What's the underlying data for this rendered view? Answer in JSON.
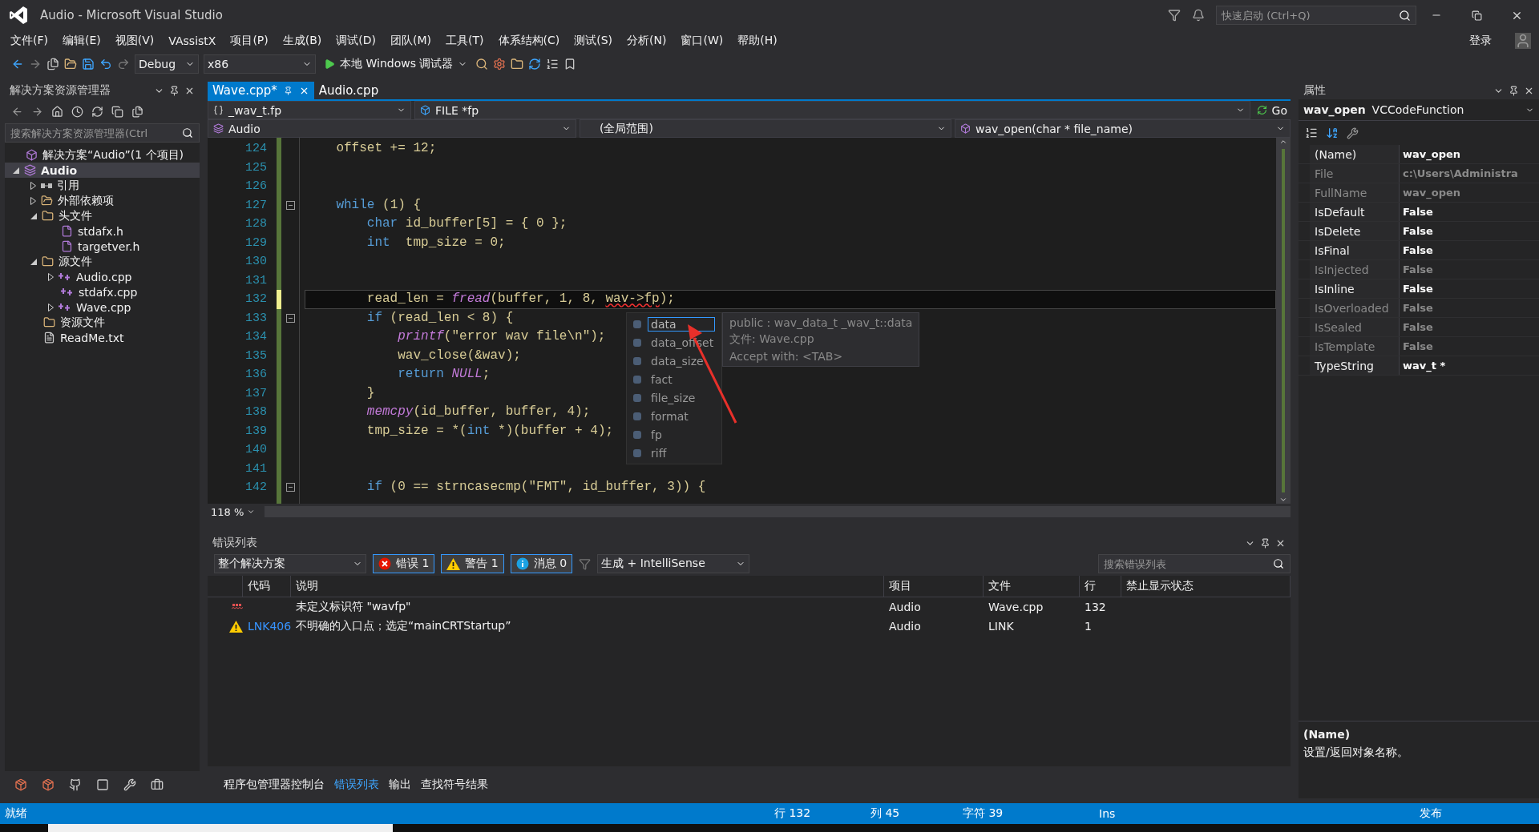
{
  "window": {
    "title": "Audio - Microsoft Visual Studio",
    "quick_launch": {
      "placeholder": "快速启动 (Ctrl+Q)"
    },
    "sign_in": "登录"
  },
  "menu": [
    "文件(F)",
    "编辑(E)",
    "视图(V)",
    "VAssistX",
    "项目(P)",
    "生成(B)",
    "调试(D)",
    "团队(M)",
    "工具(T)",
    "体系结构(C)",
    "测试(S)",
    "分析(N)",
    "窗口(W)",
    "帮助(H)"
  ],
  "toolbar": {
    "configuration": "Debug",
    "platform": "x86",
    "debugger": "本地 Windows 调试器"
  },
  "solution_explorer": {
    "title": "解决方案资源管理器",
    "search": {
      "placeholder": "搜索解决方案资源管理器(Ctrl"
    },
    "tree": [
      {
        "label": "解决方案“Audio”(1 个项目)",
        "kind": "solution",
        "selected": false
      },
      {
        "label": "Audio",
        "kind": "project",
        "selected": true,
        "expanded": true,
        "children": [
          {
            "label": "引用",
            "kind": "references",
            "selected": false,
            "expanded": false
          },
          {
            "label": "外部依赖项",
            "kind": "external",
            "selected": false,
            "expanded": false
          },
          {
            "label": "头文件",
            "kind": "folder",
            "selected": false,
            "expanded": true,
            "children": [
              {
                "label": "stdafx.h",
                "kind": "header",
                "selected": false
              },
              {
                "label": "targetver.h",
                "kind": "header",
                "selected": false
              }
            ]
          },
          {
            "label": "源文件",
            "kind": "folder",
            "selected": false,
            "expanded": true,
            "children": [
              {
                "label": "Audio.cpp",
                "kind": "cpp",
                "selected": false,
                "expanded": false
              },
              {
                "label": "stdafx.cpp",
                "kind": "cpp",
                "selected": false
              },
              {
                "label": "Wave.cpp",
                "kind": "cpp",
                "selected": false,
                "expanded": false
              }
            ]
          },
          {
            "label": "资源文件",
            "kind": "folder",
            "selected": false
          },
          {
            "label": "ReadMe.txt",
            "kind": "text",
            "selected": false
          }
        ]
      }
    ]
  },
  "editor": {
    "tabs": [
      {
        "label": "Wave.cpp*",
        "selected": true
      },
      {
        "label": "Audio.cpp",
        "selected": false
      }
    ],
    "nav_member": "_wav_t.fp",
    "nav_type": "FILE *fp",
    "go": "Go",
    "nav_project": "Audio",
    "nav_scope": "(全局范围)",
    "nav_function": "wav_open(char * file_name)",
    "zoom": "118 %",
    "lines": [
      {
        "number": "124",
        "tokens": [
          {
            "text": "    offset += 12;",
            "kind": "plain"
          }
        ]
      },
      {
        "number": "125"
      },
      {
        "number": "126"
      },
      {
        "number": "127",
        "fold": true,
        "tokens": [
          {
            "text": "    while",
            "kind": "keyword"
          },
          {
            "text": " (1) {",
            "kind": "plain"
          }
        ]
      },
      {
        "number": "128",
        "tokens": [
          {
            "text": "        char",
            "kind": "keyword"
          },
          {
            "text": " id_buffer[5] = { 0 };",
            "kind": "plain"
          }
        ]
      },
      {
        "number": "129",
        "tokens": [
          {
            "text": "        int",
            "kind": "keyword"
          },
          {
            "text": "  tmp_size = 0;",
            "kind": "plain"
          }
        ]
      },
      {
        "number": "130"
      },
      {
        "number": "131"
      },
      {
        "number": "132",
        "current": true,
        "tokens": [
          {
            "text": "        read_len = ",
            "kind": "plain"
          },
          {
            "text": "fread",
            "kind": "function"
          },
          {
            "text": "(buffer, 1, 8, ",
            "kind": "plain"
          },
          {
            "text": "wav->fp",
            "kind": "error"
          },
          {
            "text": ");",
            "kind": "plain"
          }
        ]
      },
      {
        "number": "133",
        "fold": true,
        "tokens": [
          {
            "text": "        if",
            "kind": "keyword"
          },
          {
            "text": " (read_len < 8) {",
            "kind": "plain"
          }
        ]
      },
      {
        "number": "134",
        "tokens": [
          {
            "text": "            printf",
            "kind": "function"
          },
          {
            "text": "(\"error wav file\\n\");",
            "kind": "plain"
          }
        ]
      },
      {
        "number": "135",
        "tokens": [
          {
            "text": "            wav_close(&wav);",
            "kind": "plain"
          }
        ]
      },
      {
        "number": "136",
        "tokens": [
          {
            "text": "            return",
            "kind": "keyword"
          },
          {
            "text": " NULL",
            "kind": "function"
          },
          {
            "text": ";",
            "kind": "plain"
          }
        ]
      },
      {
        "number": "137",
        "tokens": [
          {
            "text": "        }",
            "kind": "plain"
          }
        ]
      },
      {
        "number": "138",
        "tokens": [
          {
            "text": "        memcpy",
            "kind": "function"
          },
          {
            "text": "(id_buffer, buffer, 4);",
            "kind": "plain"
          }
        ]
      },
      {
        "number": "139",
        "tokens": [
          {
            "text": "        tmp_size = *(",
            "kind": "plain"
          },
          {
            "text": "int",
            "kind": "keyword"
          },
          {
            "text": " *)(buffer + 4);",
            "kind": "plain"
          }
        ]
      },
      {
        "number": "140"
      },
      {
        "number": "141"
      },
      {
        "number": "142",
        "fold": true,
        "tokens": [
          {
            "text": "        if",
            "kind": "keyword"
          },
          {
            "text": " (0 == strncasecmp(\"FMT\", id_buffer, 3)) {",
            "kind": "plain"
          }
        ]
      }
    ],
    "completion": {
      "items": [
        {
          "label": "data",
          "selected": true
        },
        {
          "label": "data_offset",
          "selected": false
        },
        {
          "label": "data_size",
          "selected": false
        },
        {
          "label": "fact",
          "selected": false
        },
        {
          "label": "file_size",
          "selected": false
        },
        {
          "label": "format",
          "selected": false
        },
        {
          "label": "fp",
          "selected": false
        },
        {
          "label": "riff",
          "selected": false
        }
      ],
      "tooltip": [
        "public : wav_data_t _wav_t::data",
        "文件: Wave.cpp",
        "Accept with: <TAB>"
      ]
    }
  },
  "error_list": {
    "title": "错误列表",
    "scope": "整个解决方案",
    "filters": [
      {
        "kind": "error",
        "label": "错误 1",
        "selected": true
      },
      {
        "kind": "warning",
        "label": "警告 1",
        "selected": true
      },
      {
        "kind": "info",
        "label": "消息 0",
        "selected": true
      }
    ],
    "source": "生成 + IntelliSense",
    "search": {
      "placeholder": "搜索错误列表"
    },
    "columns": [
      "代码",
      "说明",
      "项目",
      "文件",
      "行",
      "禁止显示状态"
    ],
    "rows": [
      {
        "kind": "error",
        "description": "未定义标识符 \"wavfp\"",
        "project": "Audio",
        "file": "Wave.cpp",
        "line": "132"
      },
      {
        "kind": "warning",
        "code": "LNK406",
        "description": "不明确的入口点；选定“mainCRTStartup”",
        "project": "Audio",
        "file": "LINK",
        "line": "1"
      }
    ]
  },
  "bottom_tabs": [
    {
      "label": "程序包管理器控制台",
      "selected": false
    },
    {
      "label": "错误列表",
      "selected": true
    },
    {
      "label": "输出",
      "selected": false
    },
    {
      "label": "查找符号结果",
      "selected": false
    }
  ],
  "properties": {
    "title": "属性",
    "object_name": "wav_open",
    "object_type": "VCCodeFunction",
    "rows": [
      {
        "name": "(Name)",
        "value": "wav_open",
        "enabled": true
      },
      {
        "name": "File",
        "value": "c:\\Users\\Administra",
        "enabled": false
      },
      {
        "name": "FullName",
        "value": "wav_open",
        "enabled": false
      },
      {
        "name": "IsDefault",
        "value": "False",
        "enabled": true
      },
      {
        "name": "IsDelete",
        "value": "False",
        "enabled": true
      },
      {
        "name": "IsFinal",
        "value": "False",
        "enabled": true
      },
      {
        "name": "IsInjected",
        "value": "False",
        "enabled": false
      },
      {
        "name": "IsInline",
        "value": "False",
        "enabled": true
      },
      {
        "name": "IsOverloaded",
        "value": "False",
        "enabled": false
      },
      {
        "name": "IsSealed",
        "value": "False",
        "enabled": false
      },
      {
        "name": "IsTemplate",
        "value": "False",
        "enabled": false
      },
      {
        "name": "TypeString",
        "value": "wav_t *",
        "enabled": true
      }
    ],
    "description_title": "(Name)",
    "description": "设置/返回对象名称。"
  },
  "status_bar": {
    "state": "就绪",
    "line": "行 132",
    "column": "列 45",
    "char": "字符 39",
    "mode": "Ins",
    "publish": "发布"
  }
}
